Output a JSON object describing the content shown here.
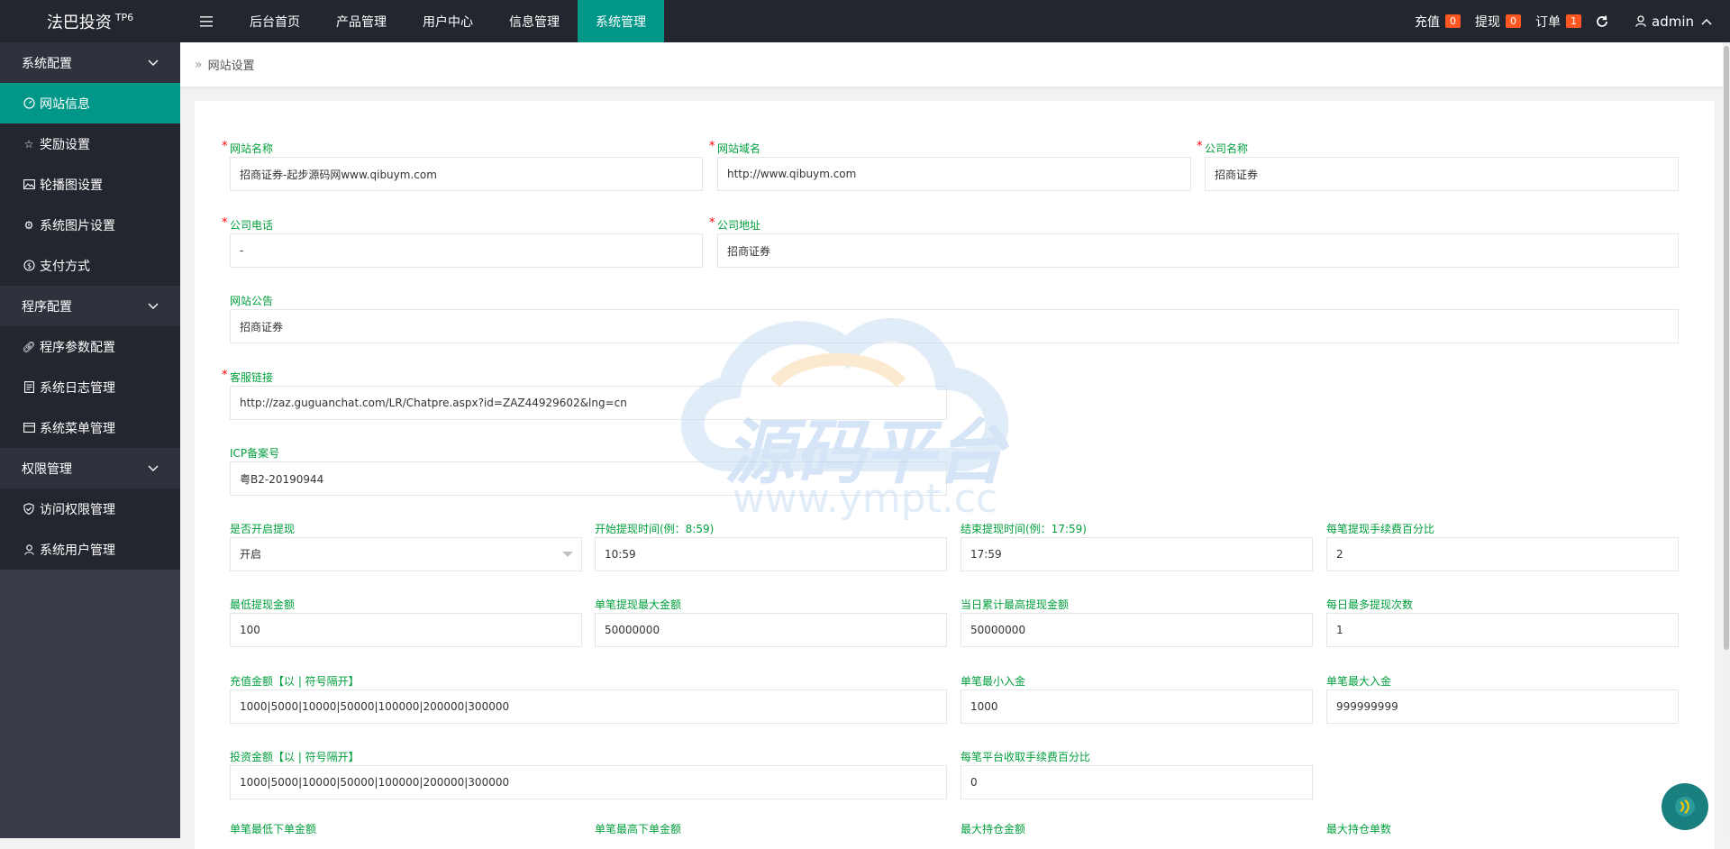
{
  "app": {
    "logo": "法巴投资",
    "logo_sup": "TP6"
  },
  "topnav": [
    {
      "label": "后台首页"
    },
    {
      "label": "产品管理"
    },
    {
      "label": "用户中心"
    },
    {
      "label": "信息管理"
    },
    {
      "label": "系统管理"
    }
  ],
  "topright": {
    "recharge_label": "充值",
    "recharge_count": "0",
    "withdraw_label": "提现",
    "withdraw_count": "0",
    "order_label": "订单",
    "order_count": "1",
    "user": "admin"
  },
  "sidebar": {
    "group1": "系统配置",
    "item_site": "网站信息",
    "item_reward": "奖励设置",
    "item_carousel": "轮播图设置",
    "item_images": "系统图片设置",
    "item_payment": "支付方式",
    "group2": "程序配置",
    "item_params": "程序参数配置",
    "item_logs": "系统日志管理",
    "item_menus": "系统菜单管理",
    "group3": "权限管理",
    "item_access": "访问权限管理",
    "item_users": "系统用户管理"
  },
  "breadcrumb": "网站设置",
  "form": {
    "site_name": {
      "label": "网站名称",
      "value": "招商证券-起步源码网www.qibuym.com"
    },
    "site_domain": {
      "label": "网站域名",
      "value": "http://www.qibuym.com"
    },
    "company_name": {
      "label": "公司名称",
      "value": "招商证券"
    },
    "company_phone": {
      "label": "公司电话",
      "value": "-"
    },
    "company_address": {
      "label": "公司地址",
      "value": "招商证券"
    },
    "site_notice": {
      "label": "网站公告",
      "value": "招商证券"
    },
    "service_link": {
      "label": "客服链接",
      "value": "http://zaz.guguanchat.com/LR/Chatpre.aspx?id=ZAZ44929602&lng=cn"
    },
    "icp": {
      "label": "ICP备案号",
      "value": "粤B2-20190944"
    },
    "withdraw_enable": {
      "label": "是否开启提现",
      "value": "开启"
    },
    "withdraw_start": {
      "label": "开始提现时间(例：8:59)",
      "value": "10:59"
    },
    "withdraw_end": {
      "label": "结束提现时间(例：17:59)",
      "value": "17:59"
    },
    "withdraw_fee": {
      "label": "每笔提现手续费百分比",
      "value": "2"
    },
    "withdraw_min": {
      "label": "最低提现金额",
      "value": "100"
    },
    "withdraw_max_single": {
      "label": "单笔提现最大金额",
      "value": "50000000"
    },
    "withdraw_max_daily": {
      "label": "当日累计最高提现金额",
      "value": "50000000"
    },
    "withdraw_times": {
      "label": "每日最多提现次数",
      "value": "1"
    },
    "recharge_amounts": {
      "label": "充值金额【以 | 符号隔开】",
      "value": "1000|5000|10000|50000|100000|200000|300000"
    },
    "deposit_min": {
      "label": "单笔最小入金",
      "value": "1000"
    },
    "deposit_max": {
      "label": "单笔最大入金",
      "value": "999999999"
    },
    "invest_amounts": {
      "label": "投资金额【以 | 符号隔开】",
      "value": "1000|5000|10000|50000|100000|200000|300000"
    },
    "platform_fee": {
      "label": "每笔平台收取手续费百分比",
      "value": "0"
    },
    "order_min": {
      "label": "单笔最低下单金额"
    },
    "order_max": {
      "label": "单笔最高下单金额"
    },
    "hold_max_amount": {
      "label": "最大持仓金额"
    },
    "hold_max_count": {
      "label": "最大持仓单数"
    }
  },
  "watermark": {
    "text": "源码平台",
    "url": "www.ympt.cc"
  },
  "colors": {
    "accent": "#009688",
    "topbar": "#23262e",
    "sidebar": "#393d49",
    "label": "#009f3c",
    "badge": "#ff5722"
  }
}
